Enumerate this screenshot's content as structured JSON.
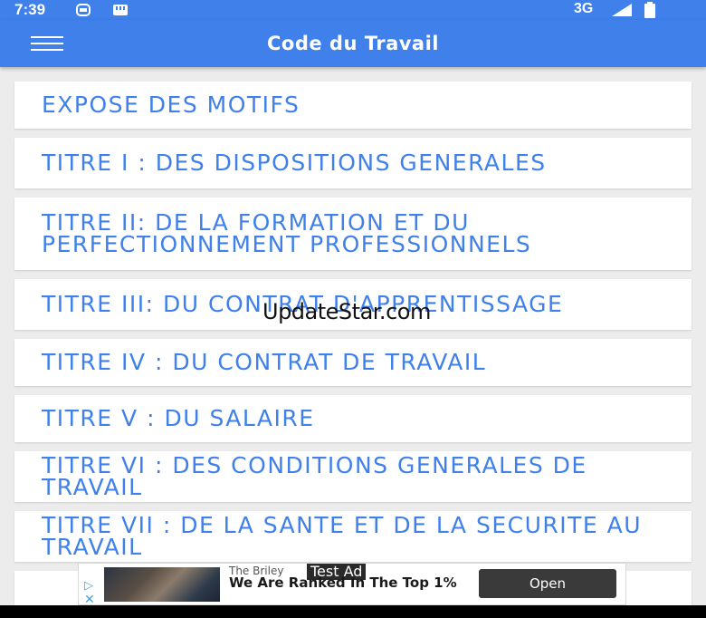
{
  "status_bar": {
    "time": "7:39",
    "network": "3G",
    "icons": [
      "sim-icon",
      "notification-icon",
      "signal-icon",
      "battery-icon"
    ]
  },
  "app_bar": {
    "title": "Code du Travail",
    "menu_icon": "hamburger-icon"
  },
  "chapters": [
    {
      "label": "EXPOSE DES MOTIFS"
    },
    {
      "label": "TITRE I : DES DISPOSITIONS GENERALES"
    },
    {
      "label": "TITRE II: DE LA FORMATION ET DU PERFECTIONNEMENT PROFESSIONNELS"
    },
    {
      "label": "TITRE III: DU CONTRAT D'APPRENTISSAGE"
    },
    {
      "label": "TITRE IV : DU CONTRAT DE TRAVAIL"
    },
    {
      "label": "TITRE V : DU SALAIRE"
    },
    {
      "label": "TITRE VI : DES CONDITIONS GENERALES DE TRAVAIL"
    },
    {
      "label": "TITRE VII : DE LA SANTE ET DE LA SECURITE AU TRAVAIL"
    }
  ],
  "watermark": "UpdateStar.com",
  "ad": {
    "badge": "Test Ad",
    "brand": "The Briley",
    "headline": "We Are Ranked In The Top 1%",
    "button": "Open",
    "info_icon": "ad-info-icon",
    "close_icon": "ad-close-icon"
  },
  "colors": {
    "primary": "#3f80ea",
    "background": "#ececec",
    "card": "#ffffff"
  }
}
